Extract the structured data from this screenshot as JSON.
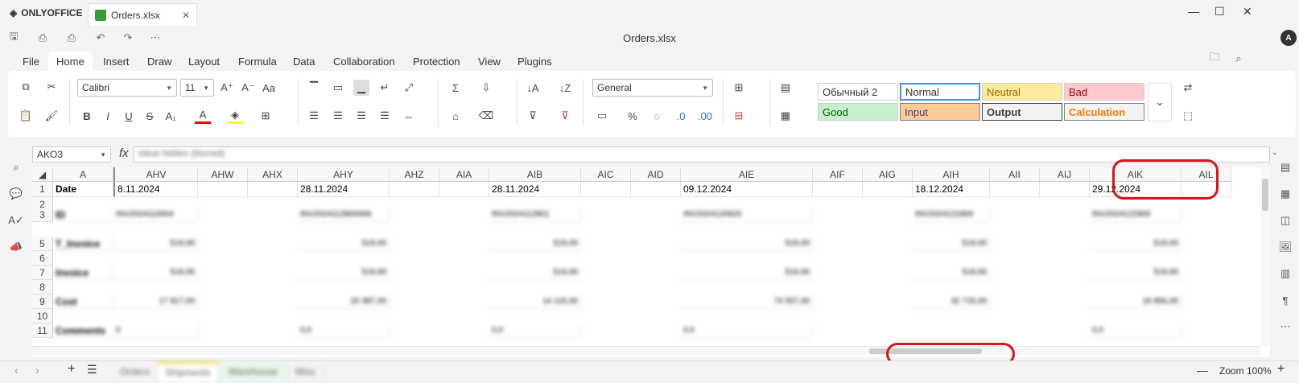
{
  "app": {
    "brand": "ONLYOFFICE",
    "tab_title": "Orders.xlsx",
    "doc_title": "Orders.xlsx",
    "avatar_initial": "A"
  },
  "menu": [
    "File",
    "Home",
    "Insert",
    "Draw",
    "Layout",
    "Formula",
    "Data",
    "Collaboration",
    "Protection",
    "View",
    "Plugins"
  ],
  "ribbon": {
    "font_name": "Calibri",
    "font_size": "11",
    "number_format": "General",
    "styles": [
      {
        "label": "Обычный 2",
        "bg": "#ffffff",
        "color": "#000000"
      },
      {
        "label": "Normal",
        "bg": "#ffffff",
        "color": "#000000"
      },
      {
        "label": "Neutral",
        "bg": "#ffeb9c",
        "color": "#9c6500"
      },
      {
        "label": "Bad",
        "bg": "#ffc7ce",
        "color": "#9c0006"
      },
      {
        "label": "Good",
        "bg": "#c6efce",
        "color": "#006100"
      },
      {
        "label": "Input",
        "bg": "#ffcc99",
        "color": "#3f3f76"
      },
      {
        "label": "Output",
        "bg": "#f2f2f2",
        "color": "#3f3f3f"
      },
      {
        "label": "Calculation",
        "bg": "#f2f2f2",
        "color": "#fa7d00"
      }
    ]
  },
  "formula_bar": {
    "cell_ref": "AKO3",
    "fx": "fx",
    "value": "Value hidden (blurred)"
  },
  "columns": [
    "A",
    "AHV",
    "AHW",
    "AHX",
    "AHY",
    "AHZ",
    "AIA",
    "AIB",
    "AIC",
    "AID",
    "AIE",
    "AIF",
    "AIG",
    "AIH",
    "AII",
    "AIJ",
    "AIK",
    "AIL"
  ],
  "rows": [
    "1",
    "2",
    "3",
    "5",
    "6",
    "7",
    "8",
    "9",
    "10",
    "11"
  ],
  "row1": {
    "A": "Date",
    "AHV": "8.11.2024",
    "AHY": "28.11.2024",
    "AIB": "28.11.2024",
    "AIE": "09.12.2024",
    "AIH": "18.12.2024",
    "AIK": "29.12.2024"
  },
  "blurred": {
    "labels": [
      "ID",
      "T_Invoice",
      "Invoice",
      "Cost",
      "Comments"
    ],
    "ids": [
      "INV2024110004",
      "INV2024112800069",
      "INV2024112801",
      "INV2024120920",
      "INV2024121800",
      "INV2024122900"
    ],
    "amt1": [
      "519,00",
      "519,00",
      "519,00",
      "519,00",
      "519,00",
      "519,00"
    ],
    "amt2": [
      "519,00",
      "519,00",
      "519,00",
      "519,00",
      "519,00",
      "519,00"
    ],
    "cost": [
      "17 917,00",
      "20 387,00",
      "14 115,00",
      "74 557,00",
      "32 715,00",
      "18 856,00"
    ],
    "comment": [
      "0",
      "0,0",
      "0,0",
      "0,0",
      "0,0"
    ]
  },
  "sheet_tabs": [
    "Orders",
    "Shipments",
    "Warehouse",
    "Misc"
  ],
  "zoom": "Zoom 100%"
}
